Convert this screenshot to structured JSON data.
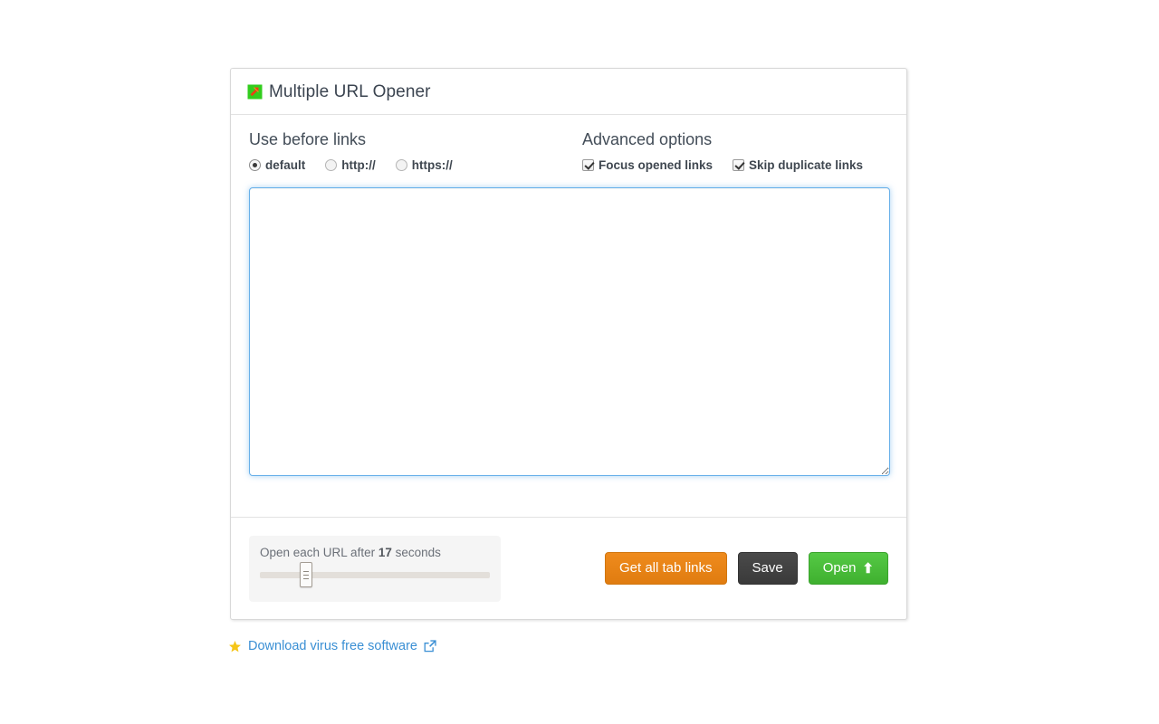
{
  "app": {
    "title": "Multiple URL Opener",
    "icon": "external-link-arrow-icon"
  },
  "use_before_links": {
    "heading": "Use before links",
    "options": [
      {
        "label": "default",
        "selected": true
      },
      {
        "label": "http://",
        "selected": false
      },
      {
        "label": "https://",
        "selected": false
      }
    ]
  },
  "advanced_options": {
    "heading": "Advanced options",
    "options": [
      {
        "label": "Focus opened links",
        "checked": true
      },
      {
        "label": "Skip duplicate links",
        "checked": true
      }
    ]
  },
  "url_input": {
    "value": "",
    "placeholder": ""
  },
  "delay_slider": {
    "prefix": "Open each URL after",
    "value": "17",
    "suffix": "seconds",
    "percent": 17.5
  },
  "actions": {
    "get_tab_links": "Get all tab links",
    "save": "Save",
    "open": "Open",
    "open_arrow": "⬆"
  },
  "footer_link": {
    "label": "Download virus free software",
    "star_icon": "star-icon",
    "external_icon": "external-link-icon"
  },
  "colors": {
    "orange": "#e07c10",
    "dark": "#3a3a3a",
    "green": "#3fb02f",
    "link_blue": "#3a8fd4",
    "focus_blue": "#66afe9",
    "star_yellow": "#f5c518"
  }
}
